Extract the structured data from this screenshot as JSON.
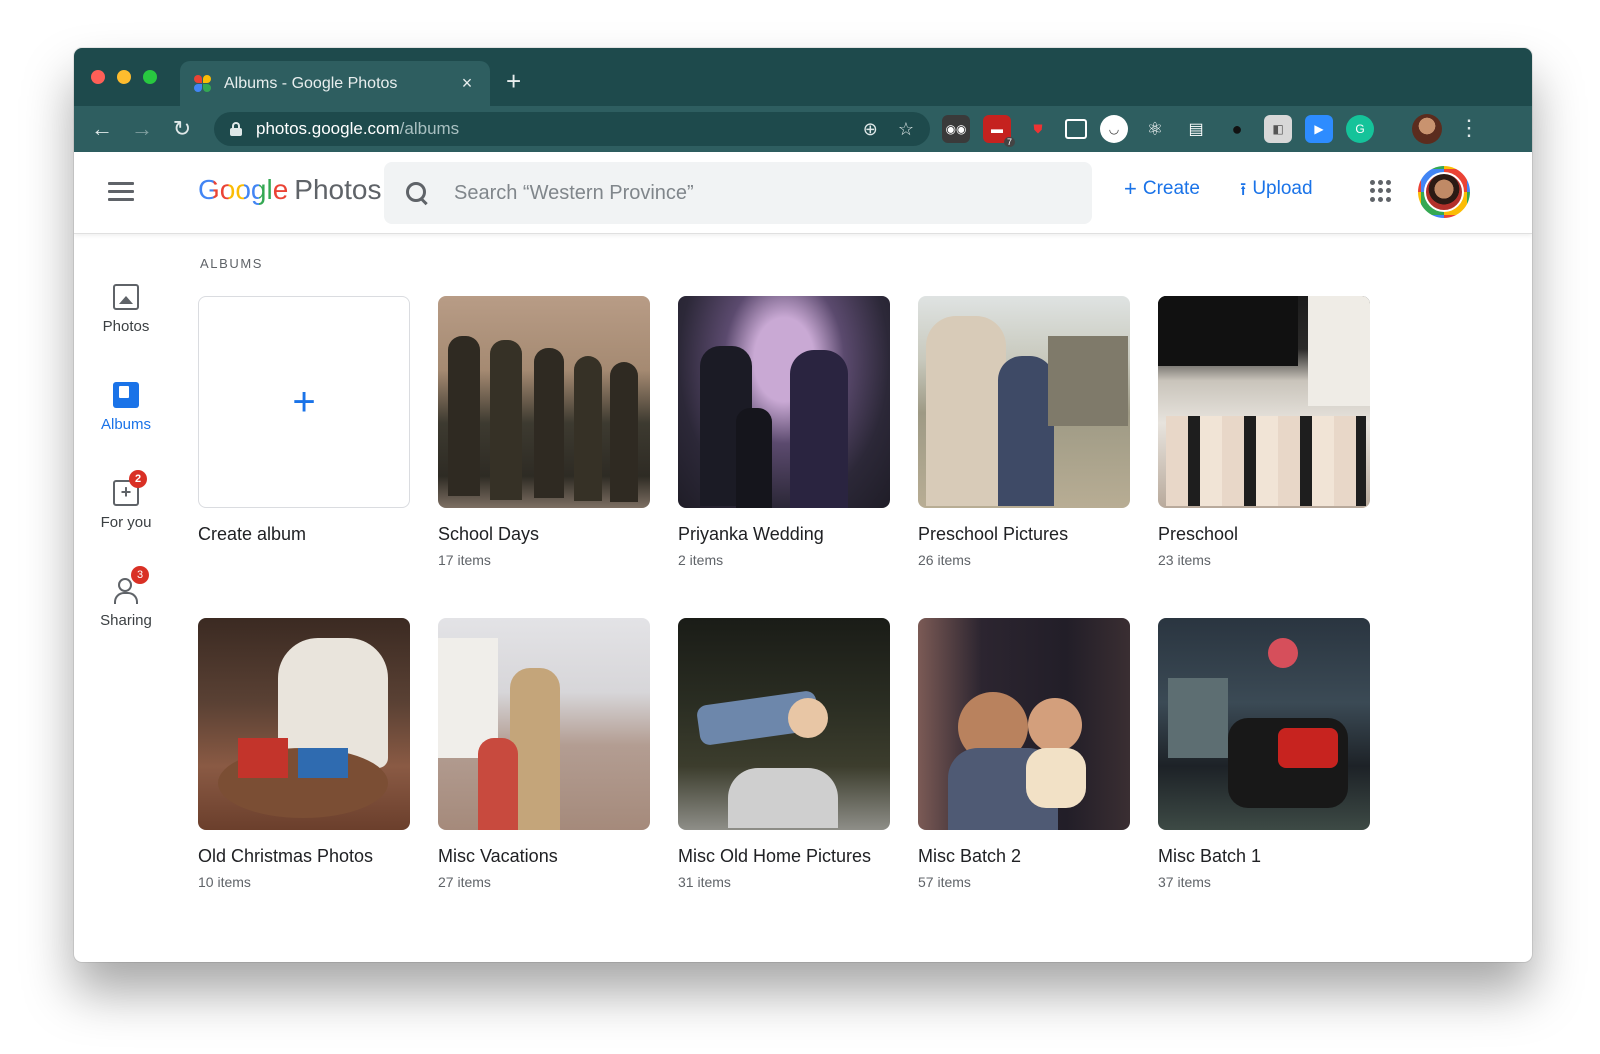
{
  "browser": {
    "tab_title": "Albums - Google Photos",
    "close_glyph": "×",
    "new_tab_glyph": "+",
    "url_host": "photos.google.com",
    "url_path": "/albums",
    "back_glyph": "←",
    "forward_glyph": "→",
    "reload_glyph": "↻",
    "menu_glyph": "⋮"
  },
  "header": {
    "logo_google": "Google",
    "logo_photos": "Photos",
    "search_placeholder": "Search “Western Province”",
    "create_label": "Create",
    "upload_label": "Upload",
    "create_glyph": "+",
    "upload_glyph": "⭱"
  },
  "sidenav": {
    "items": [
      {
        "label": "Photos",
        "icon": "photo-icon"
      },
      {
        "label": "Albums",
        "icon": "albums-icon",
        "active": true
      },
      {
        "label": "For you",
        "icon": "for-you-icon",
        "badge": "2"
      },
      {
        "label": "Sharing",
        "icon": "sharing-icon",
        "badge": "3"
      }
    ]
  },
  "main": {
    "section_title": "ALBUMS",
    "create_album_label": "Create album",
    "create_glyph": "+",
    "albums": [
      {
        "title": "School Days",
        "count": "17 items"
      },
      {
        "title": "Priyanka Wedding",
        "count": "2 items"
      },
      {
        "title": "Preschool Pictures",
        "count": "26 items"
      },
      {
        "title": "Preschool",
        "count": "23 items"
      },
      {
        "title": "Old Christmas Photos",
        "count": "10 items"
      },
      {
        "title": "Misc Vacations",
        "count": "27 items"
      },
      {
        "title": "Misc Old Home Pictures",
        "count": "31 items"
      },
      {
        "title": "Misc Batch 2",
        "count": "57 items"
      },
      {
        "title": "Misc Batch 1",
        "count": "37 items"
      }
    ]
  },
  "colors": {
    "chrome_frame": "#1e4a4c",
    "chrome_toolbar": "#2e5e60",
    "accent": "#1a73e8",
    "badge": "#d93025"
  }
}
